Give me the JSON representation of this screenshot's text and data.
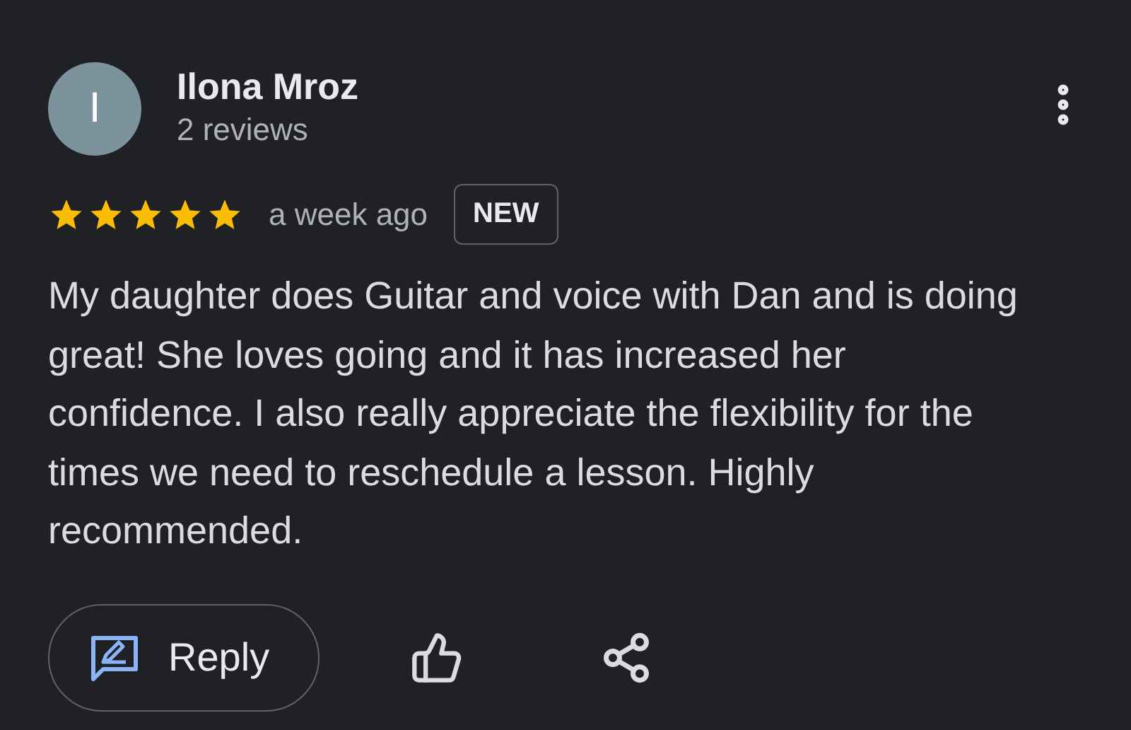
{
  "review": {
    "author": {
      "initial": "I",
      "name": "Ilona Mroz",
      "reviews": "2 reviews"
    },
    "stars": 5,
    "time": "a week ago",
    "badge": "NEW",
    "text": "My daughter does Guitar and voice with Dan and is doing great! She loves going and it has increased her confidence. I also really appreciate the flexibility for the times we need to reschedule a lesson. Highly recommended.",
    "actions": [
      {
        "kind": "reply",
        "label": "Reply"
      },
      {
        "kind": "like"
      },
      {
        "kind": "share"
      }
    ]
  }
}
